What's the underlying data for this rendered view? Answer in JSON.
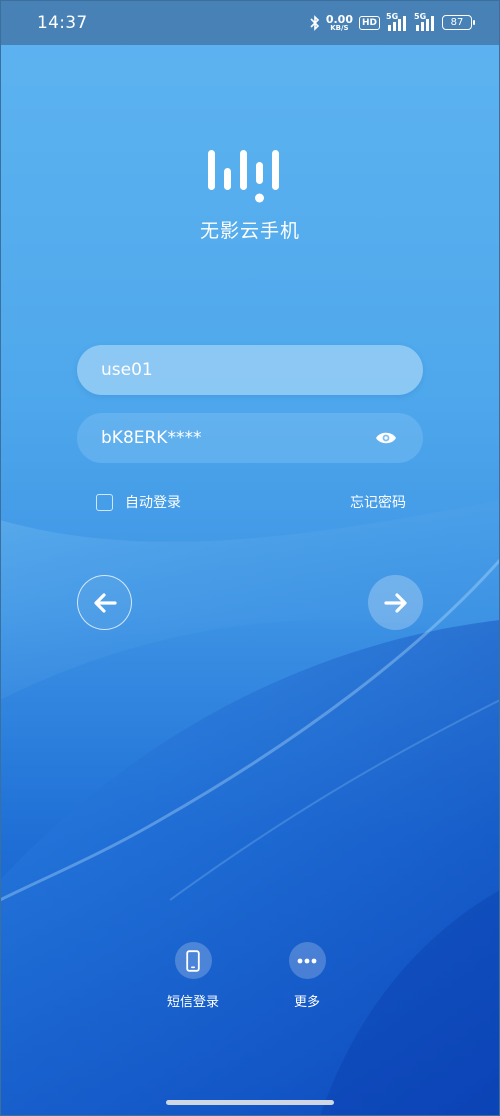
{
  "status_bar": {
    "time": "14:37",
    "net_speed_value": "0.00",
    "net_speed_unit": "KB/S",
    "hd_label": "HD",
    "signal1_label": "5G",
    "signal2_label": "5G",
    "battery": "87",
    "icons": [
      "bluetooth-icon",
      "hd-icon",
      "signal-icon",
      "battery-icon"
    ]
  },
  "app": {
    "title": "无影云手机",
    "logo_icon": "wuying-logo-icon"
  },
  "login_form": {
    "username_value": "use01",
    "password_value": "bK8ERK****",
    "show_password_icon": "eye-icon",
    "remember_label": "自动登录",
    "remember_checked": false,
    "forgot_label": "忘记密码",
    "back_icon": "arrow-left-icon",
    "next_icon": "arrow-right-icon"
  },
  "alt_login": {
    "items": [
      {
        "label": "短信登录",
        "icon": "phone-icon"
      },
      {
        "label": "更多",
        "icon": "more-icon"
      }
    ]
  },
  "colors": {
    "status_bar_bg": "#4781b6",
    "gradient_top": "#5eb4f0",
    "gradient_bottom": "#0e4fc2",
    "text": "#ffffff"
  }
}
